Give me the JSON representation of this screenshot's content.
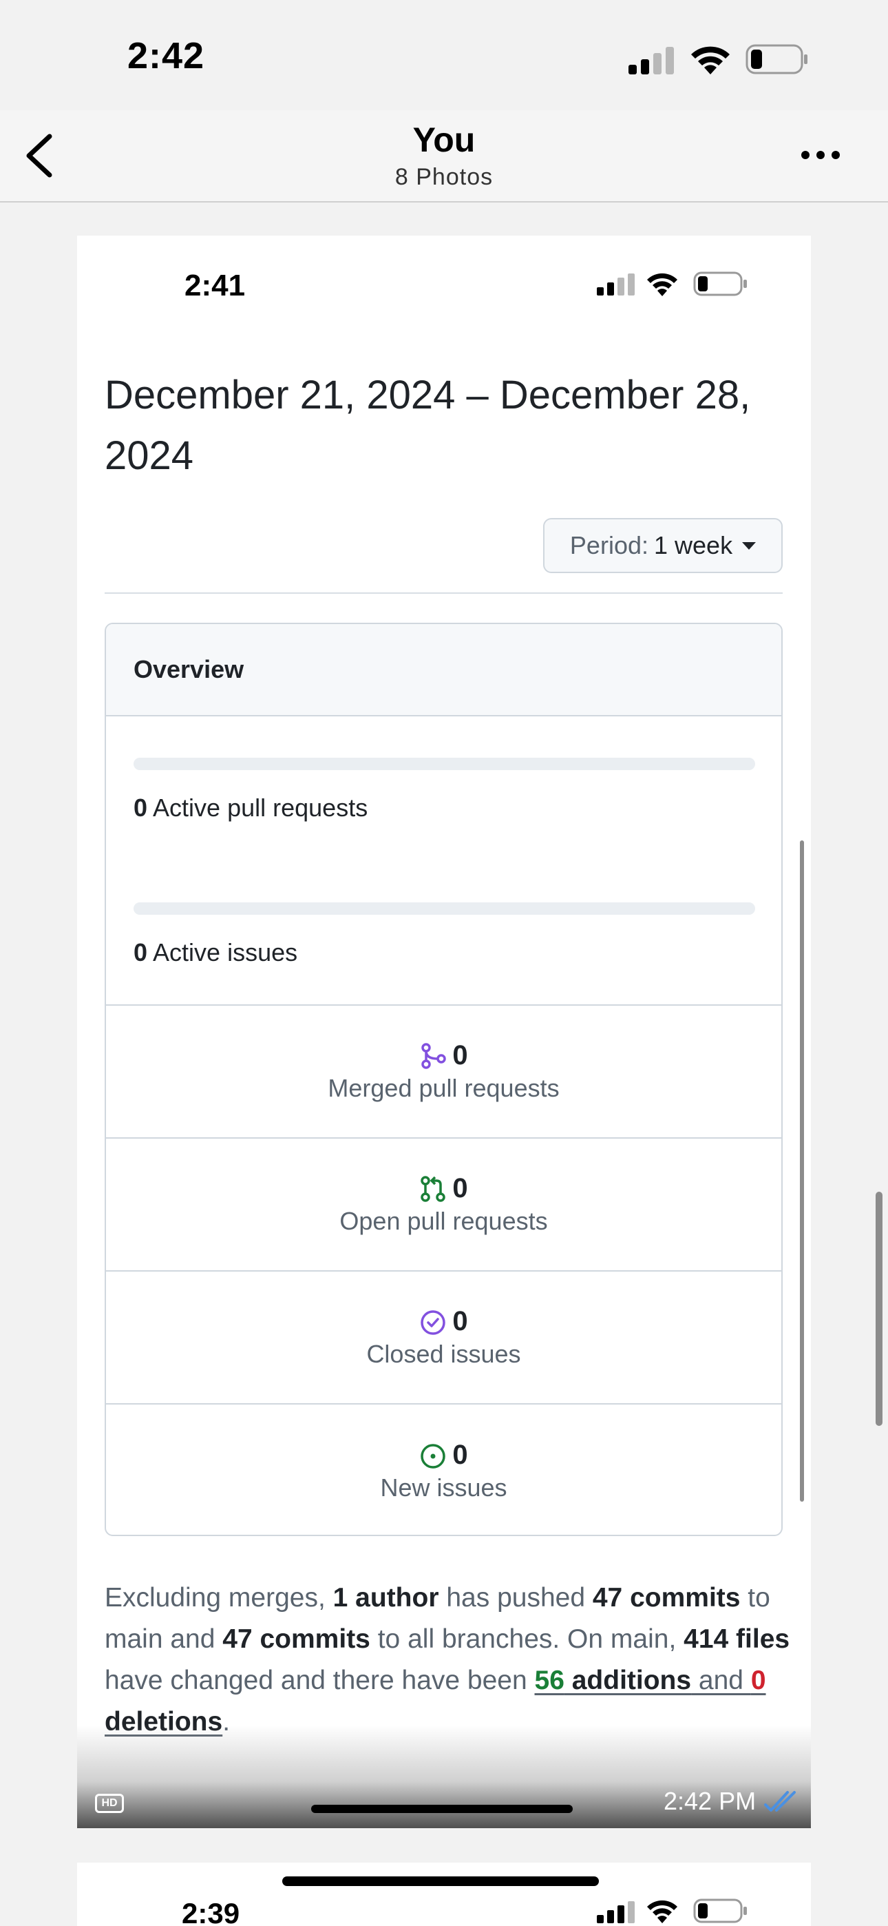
{
  "status_bar": {
    "time": "2:42"
  },
  "nav": {
    "title": "You",
    "subtitle": "8 Photos"
  },
  "photo": {
    "status_time": "2:41",
    "period_title": "December 21, 2024 – December 28, 2024",
    "period_button": {
      "label": "Period:",
      "value": "1 week"
    },
    "overview": {
      "header": "Overview",
      "active_pull_requests": {
        "count": "0",
        "label": "Active pull requests",
        "progress": 0
      },
      "active_issues": {
        "count": "0",
        "label": "Active issues",
        "progress": 0
      },
      "rows": [
        {
          "icon": "merge-icon",
          "count": "0",
          "label": "Merged pull requests",
          "color": "#8250df"
        },
        {
          "icon": "pull-request-icon",
          "count": "0",
          "label": "Open pull requests",
          "color": "#1a7f37"
        },
        {
          "icon": "issue-closed-icon",
          "count": "0",
          "label": "Closed issues",
          "color": "#8250df"
        },
        {
          "icon": "issue-opened-icon",
          "count": "0",
          "label": "New issues",
          "color": "#1a7f37"
        }
      ]
    },
    "summary": {
      "t1": "Excluding merges, ",
      "author": "1 author",
      "t2": " has pushed ",
      "commits_main": "47 commits",
      "t3": " to main and ",
      "commits_all": "47 commits",
      "t4": " to all branches. On main, ",
      "files": "414 files",
      "t5": " have changed and there have been ",
      "additions_num": "56",
      "additions_word": " additions",
      "t6": " and ",
      "deletions_num": "0",
      "deletions_word": " deletions",
      "t7": "."
    },
    "hd_badge": "HD",
    "message_time": "2:42 PM"
  },
  "next_photo": {
    "status_time": "2:39"
  }
}
